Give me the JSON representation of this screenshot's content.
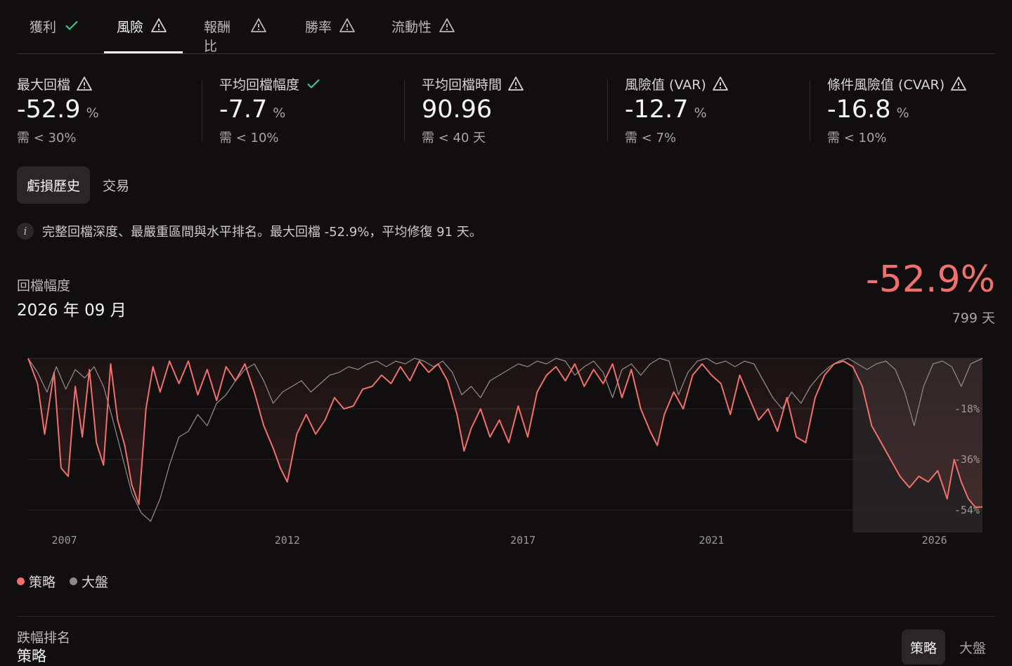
{
  "tabs": [
    {
      "label": "獲利",
      "status": "check-icon"
    },
    {
      "label": "風險",
      "status": "warning-icon"
    },
    {
      "label": "報酬比",
      "status": "warning-icon"
    },
    {
      "label": "勝率",
      "status": "warning-icon"
    },
    {
      "label": "流動性",
      "status": "warning-icon"
    }
  ],
  "active_tab": "風險",
  "metrics": [
    {
      "label": "最大回檔",
      "status": "warning-icon",
      "value": "-52.9",
      "unit": "%",
      "req": "需 < 30%"
    },
    {
      "label": "平均回檔幅度",
      "status": "check-icon",
      "value": "-7.7",
      "unit": "%",
      "req": "需 < 10%"
    },
    {
      "label": "平均回檔時間",
      "status": "warning-icon",
      "value": "90.96",
      "unit": "",
      "req": "需 < 40 天"
    },
    {
      "label": "風險值 (VAR)",
      "status": "warning-icon",
      "value": "-12.7",
      "unit": "%",
      "req": "需 < 7%"
    },
    {
      "label": "條件風險值 (CVAR)",
      "status": "warning-icon",
      "value": "-16.8",
      "unit": "%",
      "req": "需 < 10%"
    }
  ],
  "subtabs": {
    "active": "虧損歷史",
    "inactive": "交易"
  },
  "note": "完整回檔深度、最嚴重區間與水平排名。最大回檔 -52.9%，平均修復 91 天。",
  "chart_header": {
    "title": "回檔幅度",
    "date": "2026 年 09 月",
    "value": "-52.9%",
    "days": "799 天"
  },
  "legend": {
    "strategy": "策略",
    "market": "大盤"
  },
  "ranking": {
    "title": "跌幅排名",
    "subtitle": "策略",
    "seg_active": "策略",
    "seg_inactive": "大盤"
  },
  "colors": {
    "strategy": "#f0706d",
    "market": "#8c8887",
    "ok": "#3ecf8e",
    "background": "#110e0f"
  },
  "chart_data": {
    "type": "area",
    "x_range": [
      2006.5,
      2026.75
    ],
    "ylim": [
      -62,
      0
    ],
    "yticks": [
      -18,
      -36,
      -54
    ],
    "ytick_labels": [
      "-18%",
      "-36%",
      "-54%"
    ],
    "xticks": [
      2007,
      2012,
      2017,
      2021,
      2026
    ],
    "xtick_labels": [
      "2007",
      "2012",
      "2017",
      "2021",
      "2026"
    ],
    "highlight_range": [
      2024.0,
      2026.75
    ],
    "grid": true,
    "legend_position": "bottom-left",
    "series": [
      {
        "name": "策略",
        "color": "#f0706d",
        "points": [
          [
            2006.5,
            0
          ],
          [
            2006.7,
            -9
          ],
          [
            2006.85,
            -27
          ],
          [
            2007.05,
            -5
          ],
          [
            2007.2,
            -39
          ],
          [
            2007.35,
            -42
          ],
          [
            2007.5,
            -10
          ],
          [
            2007.65,
            -28
          ],
          [
            2007.8,
            -4
          ],
          [
            2007.95,
            -30
          ],
          [
            2008.1,
            -38
          ],
          [
            2008.25,
            -2
          ],
          [
            2008.4,
            -22
          ],
          [
            2008.55,
            -31
          ],
          [
            2008.7,
            -45
          ],
          [
            2008.85,
            -52
          ],
          [
            2009.0,
            -18
          ],
          [
            2009.15,
            -3
          ],
          [
            2009.3,
            -12
          ],
          [
            2009.5,
            -1
          ],
          [
            2009.7,
            -9
          ],
          [
            2009.9,
            -1
          ],
          [
            2010.1,
            -13
          ],
          [
            2010.3,
            -4
          ],
          [
            2010.5,
            -15
          ],
          [
            2010.7,
            -3
          ],
          [
            2010.9,
            -8
          ],
          [
            2011.1,
            -2
          ],
          [
            2011.3,
            -12
          ],
          [
            2011.5,
            -24
          ],
          [
            2011.7,
            -32
          ],
          [
            2011.85,
            -39
          ],
          [
            2012.0,
            -44
          ],
          [
            2012.2,
            -27
          ],
          [
            2012.4,
            -20
          ],
          [
            2012.6,
            -27
          ],
          [
            2012.8,
            -22
          ],
          [
            2013.0,
            -14
          ],
          [
            2013.2,
            -18
          ],
          [
            2013.4,
            -17
          ],
          [
            2013.6,
            -11
          ],
          [
            2013.8,
            -10
          ],
          [
            2014.0,
            -6
          ],
          [
            2014.2,
            -9
          ],
          [
            2014.4,
            -3
          ],
          [
            2014.6,
            -8
          ],
          [
            2014.8,
            -1
          ],
          [
            2015.0,
            -5
          ],
          [
            2015.2,
            -2
          ],
          [
            2015.4,
            -8
          ],
          [
            2015.6,
            -20
          ],
          [
            2015.75,
            -33
          ],
          [
            2015.9,
            -25
          ],
          [
            2016.1,
            -18
          ],
          [
            2016.3,
            -28
          ],
          [
            2016.5,
            -22
          ],
          [
            2016.7,
            -30
          ],
          [
            2016.9,
            -17
          ],
          [
            2017.1,
            -28
          ],
          [
            2017.3,
            -12
          ],
          [
            2017.5,
            -6
          ],
          [
            2017.7,
            -3
          ],
          [
            2017.9,
            -8
          ],
          [
            2018.1,
            -2
          ],
          [
            2018.3,
            -10
          ],
          [
            2018.5,
            -4
          ],
          [
            2018.7,
            -9
          ],
          [
            2018.9,
            -2
          ],
          [
            2019.1,
            -14
          ],
          [
            2019.3,
            -4
          ],
          [
            2019.5,
            -18
          ],
          [
            2019.7,
            -26
          ],
          [
            2019.85,
            -31
          ],
          [
            2020.0,
            -20
          ],
          [
            2020.2,
            -12
          ],
          [
            2020.4,
            -18
          ],
          [
            2020.6,
            -6
          ],
          [
            2020.8,
            -2
          ],
          [
            2021.0,
            -6
          ],
          [
            2021.2,
            -9
          ],
          [
            2021.4,
            -20
          ],
          [
            2021.6,
            -6
          ],
          [
            2021.8,
            -14
          ],
          [
            2022.0,
            -22
          ],
          [
            2022.2,
            -18
          ],
          [
            2022.4,
            -26
          ],
          [
            2022.6,
            -14
          ],
          [
            2022.8,
            -28
          ],
          [
            2023.0,
            -30
          ],
          [
            2023.2,
            -14
          ],
          [
            2023.4,
            -6
          ],
          [
            2023.6,
            -2
          ],
          [
            2023.8,
            -1
          ],
          [
            2024.0,
            -3
          ],
          [
            2024.2,
            -10
          ],
          [
            2024.4,
            -24
          ],
          [
            2024.6,
            -30
          ],
          [
            2024.8,
            -36
          ],
          [
            2025.0,
            -42
          ],
          [
            2025.2,
            -46
          ],
          [
            2025.4,
            -42
          ],
          [
            2025.6,
            -44
          ],
          [
            2025.8,
            -40
          ],
          [
            2026.0,
            -50
          ],
          [
            2026.15,
            -36
          ],
          [
            2026.3,
            -44
          ],
          [
            2026.45,
            -50
          ],
          [
            2026.6,
            -53
          ],
          [
            2026.75,
            -52.9
          ]
        ]
      },
      {
        "name": "大盤",
        "color": "#8c8887",
        "points": [
          [
            2006.5,
            0
          ],
          [
            2006.7,
            -5
          ],
          [
            2006.9,
            -12
          ],
          [
            2007.1,
            -3
          ],
          [
            2007.3,
            -11
          ],
          [
            2007.5,
            -4
          ],
          [
            2007.7,
            -7
          ],
          [
            2007.9,
            -3
          ],
          [
            2008.1,
            -10
          ],
          [
            2008.3,
            -22
          ],
          [
            2008.5,
            -35
          ],
          [
            2008.7,
            -48
          ],
          [
            2008.9,
            -55
          ],
          [
            2009.1,
            -58
          ],
          [
            2009.3,
            -50
          ],
          [
            2009.5,
            -38
          ],
          [
            2009.7,
            -28
          ],
          [
            2009.9,
            -26
          ],
          [
            2010.1,
            -20
          ],
          [
            2010.3,
            -24
          ],
          [
            2010.5,
            -16
          ],
          [
            2010.7,
            -13
          ],
          [
            2010.9,
            -8
          ],
          [
            2011.1,
            -4
          ],
          [
            2011.3,
            -2
          ],
          [
            2011.5,
            -8
          ],
          [
            2011.7,
            -16
          ],
          [
            2011.9,
            -12
          ],
          [
            2012.1,
            -10
          ],
          [
            2012.3,
            -8
          ],
          [
            2012.5,
            -12
          ],
          [
            2012.7,
            -9
          ],
          [
            2012.9,
            -6
          ],
          [
            2013.1,
            -5
          ],
          [
            2013.3,
            -3
          ],
          [
            2013.5,
            -4
          ],
          [
            2013.7,
            -2
          ],
          [
            2013.9,
            -1
          ],
          [
            2014.1,
            -3
          ],
          [
            2014.3,
            -1
          ],
          [
            2014.5,
            -2
          ],
          [
            2014.7,
            0
          ],
          [
            2014.9,
            -1
          ],
          [
            2015.1,
            -3
          ],
          [
            2015.3,
            -1
          ],
          [
            2015.5,
            -5
          ],
          [
            2015.7,
            -13
          ],
          [
            2015.9,
            -10
          ],
          [
            2016.1,
            -14
          ],
          [
            2016.3,
            -8
          ],
          [
            2016.5,
            -6
          ],
          [
            2016.7,
            -4
          ],
          [
            2016.9,
            -2
          ],
          [
            2017.1,
            -3
          ],
          [
            2017.3,
            -1
          ],
          [
            2017.5,
            -2
          ],
          [
            2017.7,
            0
          ],
          [
            2017.9,
            -1
          ],
          [
            2018.1,
            -6
          ],
          [
            2018.3,
            -3
          ],
          [
            2018.5,
            -1
          ],
          [
            2018.7,
            -5
          ],
          [
            2018.9,
            -14
          ],
          [
            2019.1,
            -4
          ],
          [
            2019.3,
            -2
          ],
          [
            2019.5,
            -6
          ],
          [
            2019.7,
            -2
          ],
          [
            2019.9,
            0
          ],
          [
            2020.1,
            -1
          ],
          [
            2020.3,
            -13
          ],
          [
            2020.5,
            -5
          ],
          [
            2020.7,
            -1
          ],
          [
            2020.9,
            0
          ],
          [
            2021.1,
            -2
          ],
          [
            2021.3,
            -1
          ],
          [
            2021.5,
            -3
          ],
          [
            2021.7,
            -1
          ],
          [
            2021.9,
            -2
          ],
          [
            2022.1,
            -8
          ],
          [
            2022.3,
            -14
          ],
          [
            2022.5,
            -18
          ],
          [
            2022.7,
            -12
          ],
          [
            2022.9,
            -16
          ],
          [
            2023.1,
            -10
          ],
          [
            2023.3,
            -6
          ],
          [
            2023.5,
            -3
          ],
          [
            2023.7,
            -1
          ],
          [
            2023.9,
            0
          ],
          [
            2024.1,
            -2
          ],
          [
            2024.3,
            -4
          ],
          [
            2024.5,
            -2
          ],
          [
            2024.7,
            -1
          ],
          [
            2024.9,
            -4
          ],
          [
            2025.1,
            -12
          ],
          [
            2025.3,
            -24
          ],
          [
            2025.5,
            -10
          ],
          [
            2025.7,
            -2
          ],
          [
            2025.9,
            -1
          ],
          [
            2026.1,
            -3
          ],
          [
            2026.3,
            -10
          ],
          [
            2026.5,
            -2
          ],
          [
            2026.75,
            0
          ]
        ]
      }
    ]
  }
}
